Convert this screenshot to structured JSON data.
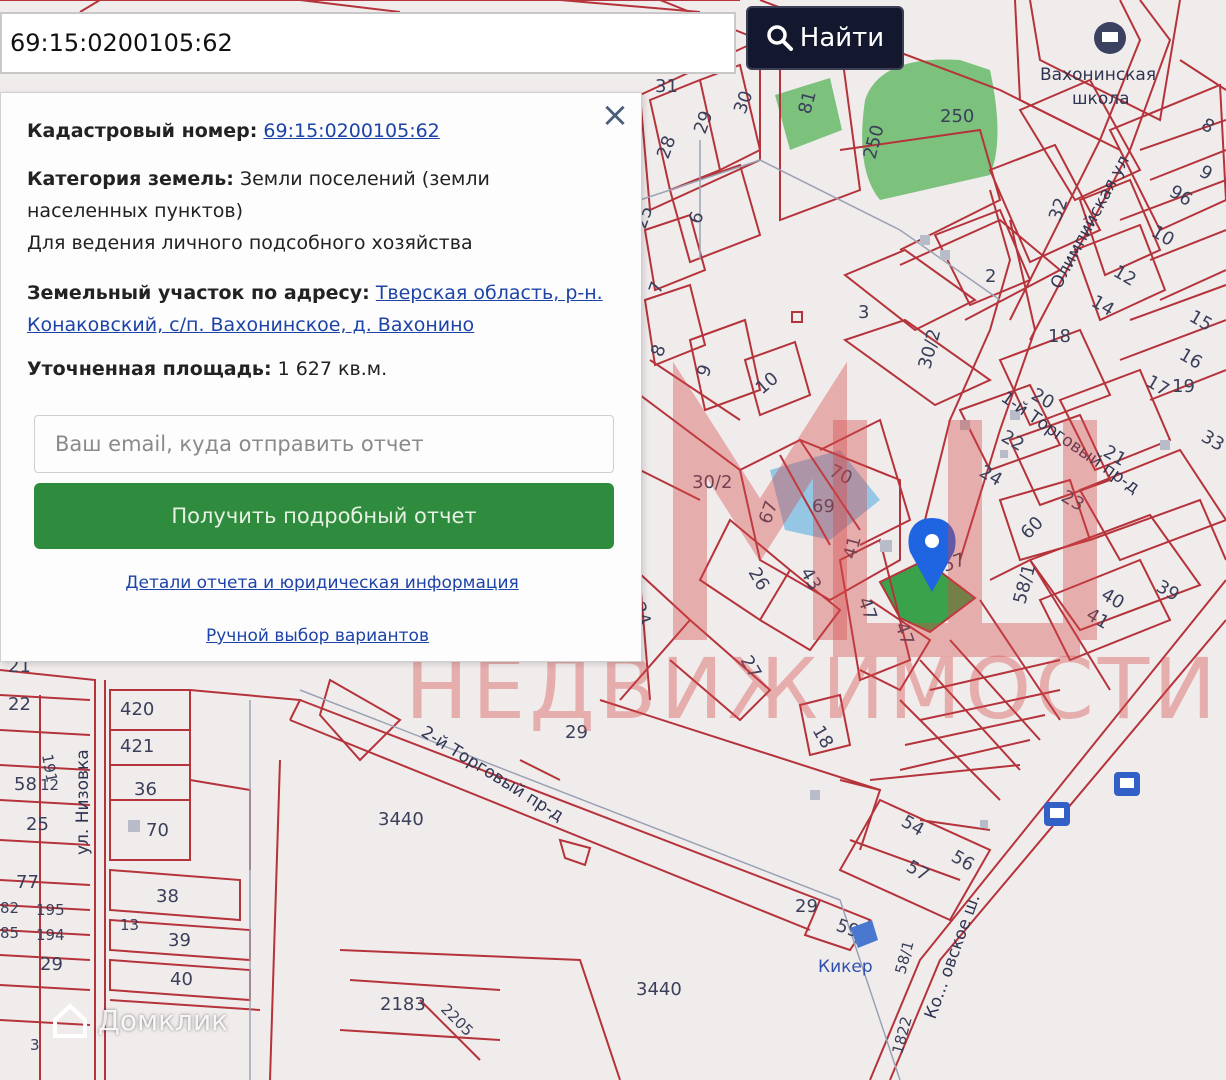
{
  "search": {
    "value": "69:15:0200105:62",
    "button_label": "Найти"
  },
  "popup": {
    "cadastral_label": "Кадастровый номер:",
    "cadastral_value": "69:15:0200105:62",
    "category_label": "Категория земель:",
    "category_value": "Земли поселений (земли",
    "category_value_cont": "населенных пунктов)",
    "usage": "Для ведения личного подсобного хозяйства",
    "address_label": "Земельный участок по адресу:",
    "address_line1": "Тверская область, р-н.",
    "address_line2": "Конаковский, с/п. Вахонинское, д. Вахонино",
    "area_label": "Уточненная площадь:",
    "area_value": "1 627 кв.м.",
    "email_placeholder": "Ваш email, куда отправить отчет",
    "report_button": "Получить подробный отчет",
    "details_link": "Детали отчета и юридическая информация",
    "manual_link": "Ручной выбор вариантов"
  },
  "map": {
    "school_label_1": "Вахонинская",
    "school_label_2": "школа",
    "street_olimp": "Олимпийская ул",
    "street_torg1": "1-й Торговый пр-д",
    "street_torg2": "2-й Торговый пр-д",
    "street_nizovka": "ул. Низовка",
    "street_konakovo": "Ко... овское ш.",
    "place_kiker": "Кикер",
    "parcel_numbers": [
      "250",
      "250",
      "81",
      "30",
      "29",
      "28",
      "31",
      "25",
      "6",
      "7",
      "8",
      "9",
      "10",
      "3",
      "30/2",
      "32",
      "2",
      "18",
      "12",
      "14",
      "15",
      "16",
      "17",
      "19",
      "20",
      "21",
      "22",
      "23",
      "24",
      "33",
      "30/2",
      "70",
      "69",
      "67",
      "41",
      "26",
      "43",
      "47",
      "47",
      "60",
      "57",
      "58/1",
      "39",
      "40",
      "41",
      "24",
      "27",
      "18",
      "29",
      "21",
      "22",
      "191",
      "58",
      "12",
      "25",
      "77",
      "82",
      "195",
      "85",
      "194",
      "29",
      "420",
      "421",
      "36",
      "70",
      "38",
      "39",
      "40",
      "3440",
      "3440",
      "54",
      "56",
      "57",
      "29",
      "59",
      "58/1",
      "2183",
      "2205",
      "1822",
      "96",
      "10",
      "8",
      "9",
      "13",
      "3"
    ]
  },
  "watermark": {
    "text": "НЕДВИЖИМОСТИ",
    "brand": "Домклик"
  },
  "colors": {
    "parcel_line": "#b5333a",
    "selected_parcel": "#3aa24a",
    "green_area": "#77c07a",
    "button_green": "#2f8c3e",
    "find_button": "#13182e",
    "link": "#1d43a8",
    "marker": "#1f64e0"
  },
  "icons": {
    "search": "search-icon",
    "close": "close-icon",
    "marker": "map-pin-icon",
    "school": "school-icon",
    "bus_stop": "bus-stop-icon"
  }
}
